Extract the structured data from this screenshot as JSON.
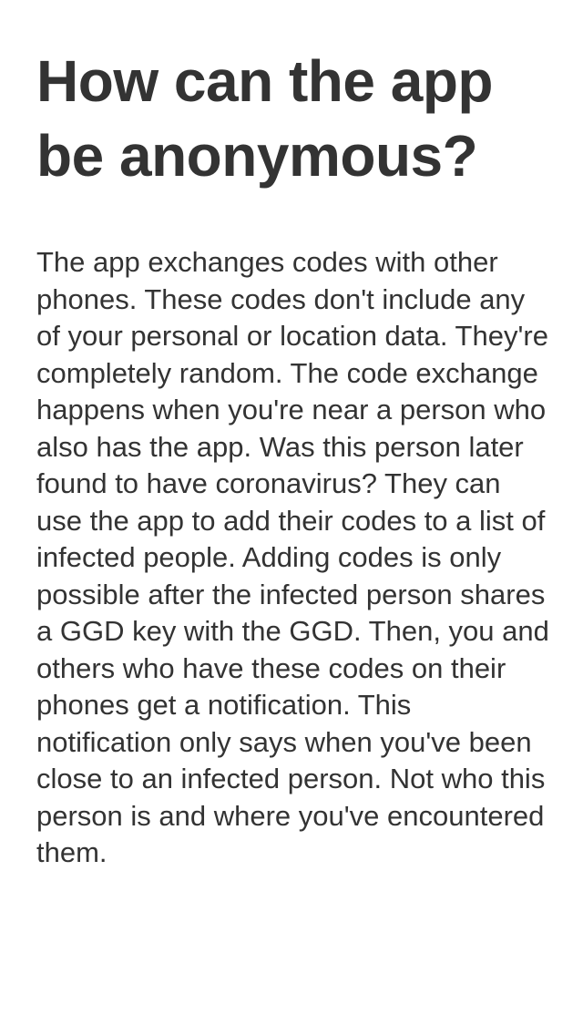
{
  "page": {
    "title": "How can the app be anonymous?",
    "body": "The app exchanges codes with other phones. These codes don't include any of your personal or location data. They're completely random. The code exchange happens when you're near a person who also has the app. Was this person later found to have coronavirus? They can use the app to add their codes to a list of infected people. Adding codes is only possible after the infected person shares a GGD key with the GGD. Then, you and others who have these codes on their phones get a notification. This notification only says when you've been close to an infected person. Not who this person is and where you've encountered them."
  },
  "colors": {
    "background": "#ffffff",
    "text": "#333333"
  }
}
